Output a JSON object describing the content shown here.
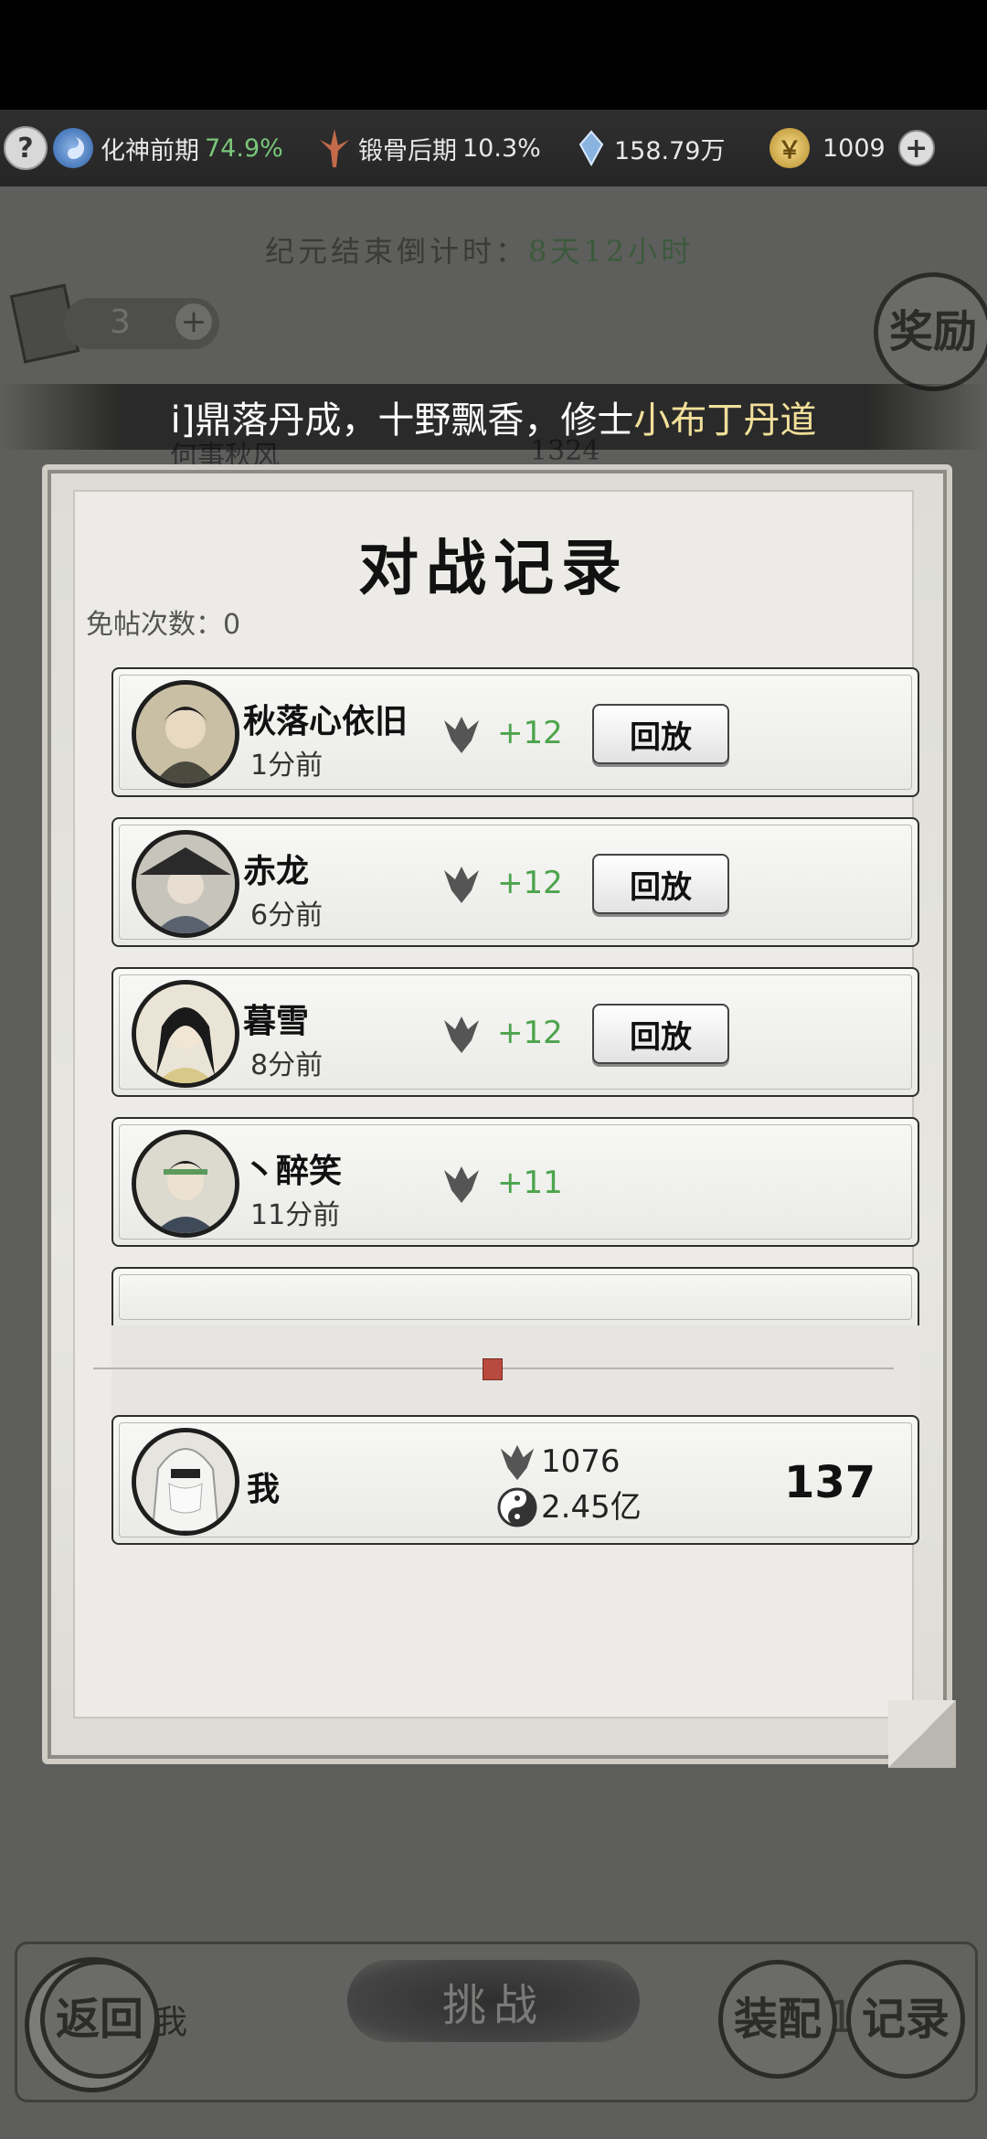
{
  "topbar": {
    "help_icon": "question-mark-icon",
    "realm1_name": "化神前期",
    "realm1_pct": "74.9%",
    "realm2_name": "锻骨后期",
    "realm2_pct": "10.3%",
    "spirit_stones": "158.79万",
    "coins": "1009",
    "plus_icon": "plus-icon"
  },
  "background": {
    "countdown_label": "纪元结束倒计时：",
    "countdown_value": "8天12小时",
    "tickets": "3",
    "reward_label": "奖励",
    "bg_player_name": "何事秋风",
    "bg_player_score": "1324",
    "bottom_name": "我",
    "bottom_score": "1076",
    "bottom_rank": "137",
    "back_label": "返回",
    "challenge_label": "挑战",
    "equip_label": "装配",
    "record_label": "记录"
  },
  "announcement": {
    "prefix": "i]鼎落丹成，十野飘香，修士",
    "highlight": "小布丁丹道"
  },
  "dialog": {
    "title": "对战记录",
    "free_count": "免帖次数：0",
    "replay_label": "回放",
    "records": [
      {
        "name": "秋落心依旧",
        "time": "1分前",
        "score": "+12",
        "has_replay": true
      },
      {
        "name": "赤龙",
        "time": "6分前",
        "score": "+12",
        "has_replay": true
      },
      {
        "name": "暮雪",
        "time": "8分前",
        "score": "+12",
        "has_replay": true
      },
      {
        "name": "丶醉笑",
        "time": "11分前",
        "score": "+11",
        "has_replay": false
      }
    ],
    "me": {
      "name": "我",
      "rating": "1076",
      "power": "2.45亿",
      "rank": "137"
    }
  },
  "colors": {
    "positive_score": "#4ca44c",
    "announcement_highlight": "#f2e09a",
    "realm_pct": "#7ac77a"
  }
}
